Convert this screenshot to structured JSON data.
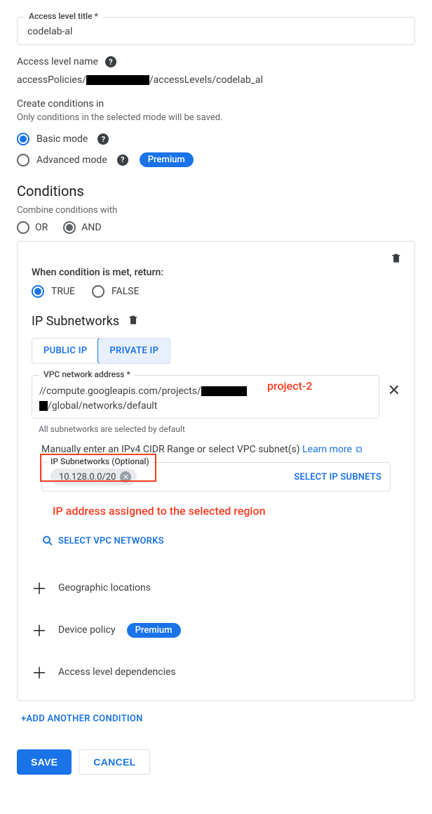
{
  "accessLevel": {
    "titleLabel": "Access level title *",
    "titleValue": "codelab-al",
    "nameLabel": "Access level name",
    "namePrefix": "accessPolicies/",
    "nameMid": "/accessLevels/",
    "nameSuffix": "codelab_al"
  },
  "createConditions": {
    "heading": "Create conditions in",
    "subtext": "Only conditions in the selected mode will be saved.",
    "basicLabel": "Basic mode",
    "advancedLabel": "Advanced mode",
    "premiumBadge": "Premium"
  },
  "conditions": {
    "heading": "Conditions",
    "combineLabel": "Combine conditions with",
    "orLabel": "OR",
    "andLabel": "AND"
  },
  "card": {
    "whenMet": "When condition is met, return:",
    "trueLabel": "TRUE",
    "falseLabel": "FALSE",
    "ipHeading": "IP Subnetworks",
    "tabPublic": "PUBLIC IP",
    "tabPrivate": "PRIVATE IP",
    "vpcLabel": "VPC network address *",
    "vpcLine1a": "//compute.googleapis.com/projects/",
    "vpcLine2b": "/global/networks/default",
    "helperText": "All subnetworks are selected by default",
    "manualText": "Manually enter an IPv4 CIDR Range or select VPC subnet(s) ",
    "learnMore": "Learn more",
    "subnetLegend": "IP Subnetworks (Optional)",
    "subnetChip": "10.128.0.0/20",
    "selectSubnets": "SELECT IP SUBNETS",
    "selectVpc": "SELECT VPC NETWORKS",
    "geoLabel": "Geographic locations",
    "deviceLabel": "Device policy",
    "depsLabel": "Access level dependencies"
  },
  "annotations": {
    "project2": "project-2",
    "ipAssigned": "IP address assigned to the selected region"
  },
  "footer": {
    "addCondition": "+ADD ANOTHER CONDITION",
    "save": "SAVE",
    "cancel": "CANCEL"
  }
}
